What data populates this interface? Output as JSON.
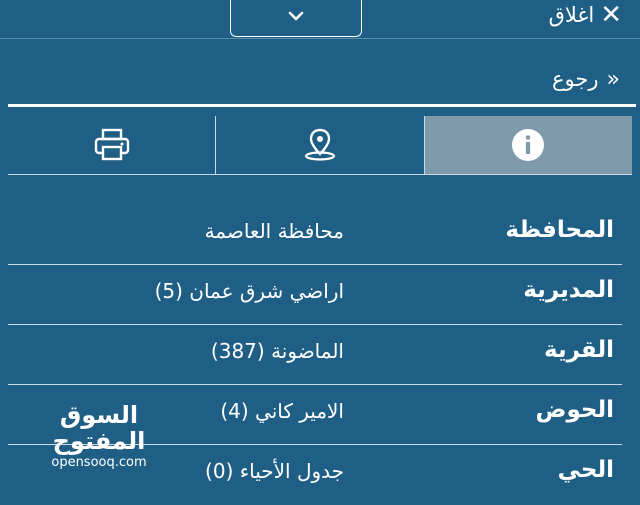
{
  "header": {
    "close_label": "اغلاق",
    "close_icon": "close-icon",
    "dropdown_icon": "chevron-down-icon"
  },
  "back": {
    "label": "رجوع",
    "icon": "double-chevron-icon"
  },
  "tabs": [
    {
      "name": "print",
      "icon": "printer-icon",
      "active": false
    },
    {
      "name": "location",
      "icon": "map-pin-icon",
      "active": false
    },
    {
      "name": "info",
      "icon": "info-icon",
      "active": true
    }
  ],
  "details": [
    {
      "key": "المحافظة",
      "value": "محافظة العاصمة"
    },
    {
      "key": "المديرية",
      "value": "اراضي شرق عمان (5)"
    },
    {
      "key": "القرية",
      "value": "الماضونة (387)"
    },
    {
      "key": "الحوض",
      "value": "الامير كاني (4)"
    },
    {
      "key": "الحي",
      "value": "جدول الأحياء (0)"
    }
  ],
  "watermark": {
    "arabic": "السوق المفتوح",
    "latin": "opensooq.com"
  },
  "colors": {
    "background": "#1f5f86",
    "active_tab": "#7e9aab",
    "text": "#ffffff"
  }
}
